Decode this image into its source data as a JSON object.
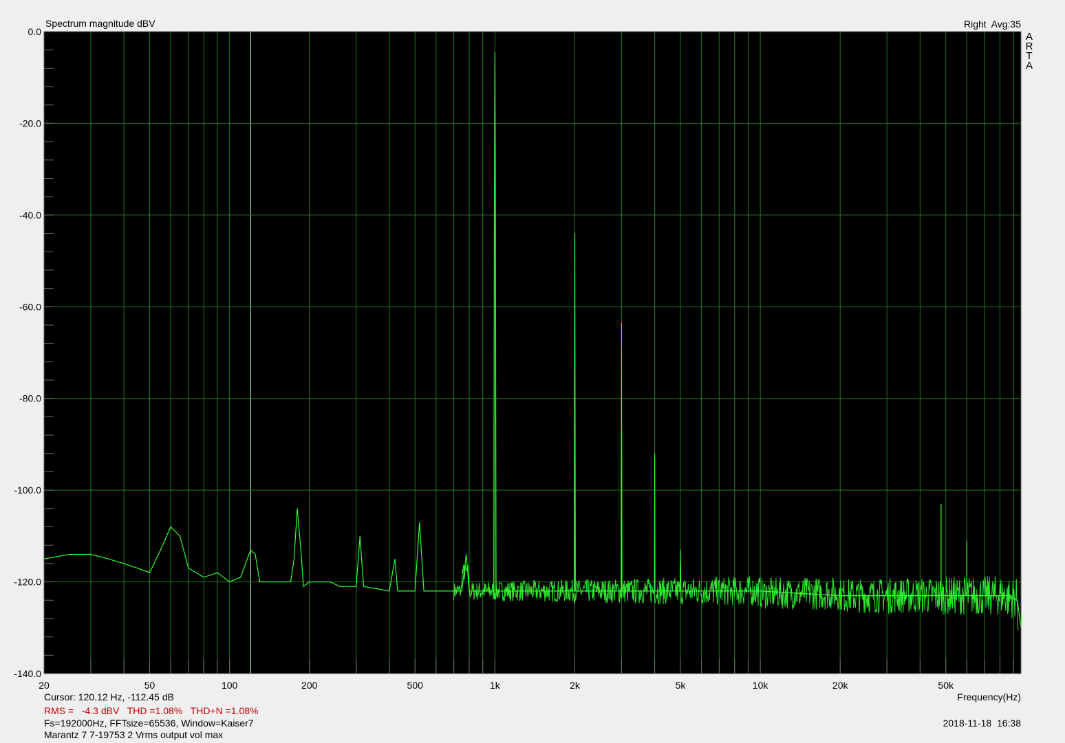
{
  "header": {
    "title": "Spectrum magnitude dBV",
    "channel": "Right  Avg:35",
    "logo": "ARTA"
  },
  "footer": {
    "cursor": "Cursor: 120.12 Hz, -112.45 dB",
    "stats": "RMS =   -4.3 dBV   THD =1.08%   THD+N =1.08%",
    "fs_info": "Fs=192000Hz, FFTsize=65536, Window=Kaiser7",
    "timestamp": "2018-11-18  16:38",
    "description": "Marantz 7 7-19753 2 Vrms output vol max",
    "x_axis_label": "Frequency(Hz)"
  },
  "colors": {
    "plot_background": "#000000",
    "grid": "#1f7a1f",
    "trace": "#33ff33",
    "stats_text": "#c00000"
  },
  "chart_data": {
    "type": "line",
    "title": "Spectrum magnitude dBV",
    "xlabel": "Frequency(Hz)",
    "ylabel": "",
    "x_scale": "log",
    "xlim": [
      20,
      96000
    ],
    "ylim": [
      -140,
      0
    ],
    "grid": true,
    "x_ticks": [
      20,
      50,
      100,
      200,
      500,
      1000,
      2000,
      5000,
      10000,
      20000,
      50000
    ],
    "x_tick_labels": [
      "20",
      "50",
      "100",
      "200",
      "500",
      "1k",
      "2k",
      "5k",
      "10k",
      "20k",
      "50k"
    ],
    "y_ticks": [
      0,
      -20,
      -40,
      -60,
      -80,
      -100,
      -120,
      -140
    ],
    "y_tick_labels": [
      "0.0",
      "-20.0",
      "-40.0",
      "-60.0",
      "-80.0",
      "-100.0",
      "-120.0",
      "-140.0"
    ],
    "series": [
      {
        "x": [
          20,
          25,
          30,
          35,
          40,
          45,
          50,
          55,
          60,
          65,
          70,
          80,
          90,
          100,
          110,
          115,
          120,
          125,
          130,
          150,
          170,
          175,
          180,
          185,
          190,
          200,
          220,
          240,
          260,
          280,
          300,
          310,
          320,
          400,
          420,
          430,
          450,
          500,
          520,
          540,
          560,
          600,
          650,
          700,
          750,
          780,
          800,
          900,
          950,
          990,
          995,
          1000,
          1005,
          1010,
          1050,
          1200,
          1500,
          1900,
          1990,
          2000,
          2010,
          2100,
          2800,
          2990,
          3000,
          3010,
          3200,
          3900,
          3990,
          4000,
          4010,
          4500,
          4990,
          5000,
          5010,
          6000,
          10000,
          20000,
          40000,
          47990,
          48000,
          48010,
          55000,
          59990,
          60000,
          60010,
          70000,
          85000,
          93000,
          96000
        ],
        "y": [
          -115,
          -114,
          -114,
          -115,
          -116,
          -117,
          -118,
          -113,
          -108,
          -110,
          -117,
          -119,
          -118,
          -120,
          -119,
          -116,
          -113,
          -114,
          -120,
          -120,
          -120,
          -115,
          -104,
          -112,
          -121,
          -120,
          -120,
          -120,
          -121,
          -121,
          -121,
          -110,
          -121,
          -122,
          -115,
          -122,
          -122,
          -122,
          -107,
          -122,
          -122,
          -122,
          -122,
          -122,
          -122,
          -114,
          -122,
          -122,
          -122,
          -122,
          -40,
          -4.5,
          -40,
          -122,
          -122,
          -122,
          -122,
          -122,
          -122,
          -44,
          -122,
          -122,
          -122,
          -122,
          -63.5,
          -122,
          -122,
          -122,
          -122,
          -92,
          -122,
          -122,
          -122,
          -113,
          -122,
          -122,
          -122,
          -123,
          -123,
          -123,
          -103,
          -123,
          -123,
          -123,
          -111,
          -123,
          -123,
          -123,
          -124,
          -130
        ]
      }
    ],
    "annotations": [
      "Cursor: 120.12 Hz, -112.45 dB"
    ]
  }
}
